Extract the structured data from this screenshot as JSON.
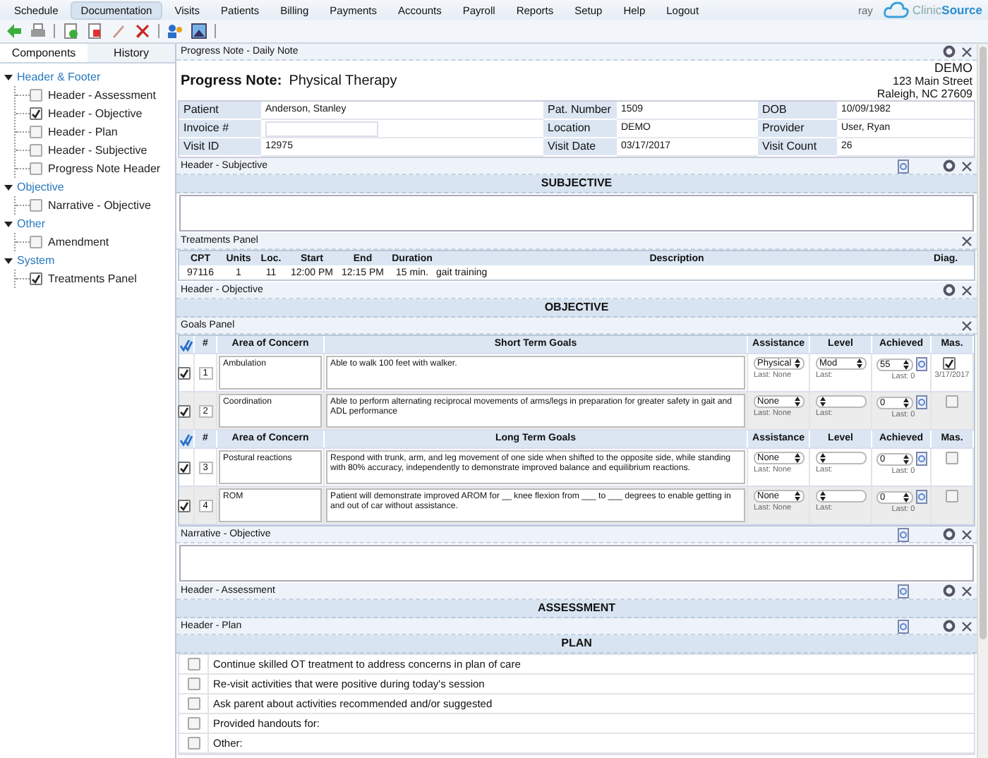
{
  "menu": [
    {
      "label": "Schedule",
      "selected": false
    },
    {
      "label": "Documentation",
      "selected": true
    },
    {
      "label": "Visits",
      "selected": false
    },
    {
      "label": "Patients",
      "selected": false
    },
    {
      "label": "Billing",
      "selected": false
    },
    {
      "label": "Payments",
      "selected": false
    },
    {
      "label": "Accounts",
      "selected": false
    },
    {
      "label": "Payroll",
      "selected": false
    },
    {
      "label": "Reports",
      "selected": false
    },
    {
      "label": "Setup",
      "selected": false
    },
    {
      "label": "Help",
      "selected": false
    },
    {
      "label": "Logout",
      "selected": false
    }
  ],
  "user": "ray",
  "logo": {
    "text_1": "Clinic",
    "text_2": "Source"
  },
  "sidebar": {
    "tabs": [
      {
        "label": "Components",
        "selected": true
      },
      {
        "label": "History",
        "selected": false
      }
    ],
    "groups": [
      {
        "label": "Header & Footer",
        "children": [
          {
            "label": "Header - Assessment",
            "checked": false
          },
          {
            "label": "Header - Objective",
            "checked": true
          },
          {
            "label": "Header - Plan",
            "checked": false
          },
          {
            "label": "Header - Subjective",
            "checked": false
          },
          {
            "label": "Progress Note Header",
            "checked": false
          }
        ]
      },
      {
        "label": "Objective",
        "children": [
          {
            "label": "Narrative - Objective",
            "checked": false
          }
        ]
      },
      {
        "label": "Other",
        "children": [
          {
            "label": "Amendment",
            "checked": false
          }
        ]
      },
      {
        "label": "System",
        "children": [
          {
            "label": "Treatments Panel",
            "checked": true
          }
        ]
      }
    ]
  },
  "note": {
    "panel_title": "Progress Note - Daily Note",
    "heading_label": "Progress Note:",
    "heading_value": "Physical Therapy",
    "clinic": [
      "DEMO",
      "123 Main Street",
      "Raleigh, NC 27609"
    ],
    "fields": [
      [
        {
          "label": "Patient",
          "value": "Anderson, Stanley"
        },
        {
          "label": "Pat. Number",
          "value": "1509"
        },
        {
          "label": "DOB",
          "value": "10/09/1982"
        }
      ],
      [
        {
          "label": "Invoice #",
          "kind": "input"
        },
        {
          "label": "Location",
          "value": "DEMO"
        },
        {
          "label": "Provider",
          "value": "User, Ryan"
        }
      ],
      [
        {
          "label": "Visit ID",
          "value": "12975"
        },
        {
          "label": "Visit Date",
          "value": "03/17/2017"
        },
        {
          "label": "Visit Count",
          "value": "26"
        }
      ]
    ]
  },
  "blocks": [
    {
      "kind": "bar",
      "title": "Header - Subjective",
      "copy": true,
      "settings": true
    },
    {
      "kind": "banner",
      "text": "SUBJECTIVE"
    },
    {
      "kind": "textarea"
    },
    {
      "kind": "bar",
      "title": "Treatments Panel",
      "copy": false,
      "settings": false
    },
    {
      "kind": "treatments",
      "columns": [
        "CPT",
        "Units",
        "Loc.",
        "Start",
        "End",
        "Duration",
        "Description",
        "Diag."
      ],
      "rows": [
        [
          "97116",
          "1",
          "11",
          "12:00 PM",
          "12:15 PM",
          "15 min.",
          "gait training"
        ]
      ]
    },
    {
      "kind": "bar",
      "title": "Header - Objective",
      "copy": false,
      "settings": true
    },
    {
      "kind": "banner",
      "text": "OBJECTIVE"
    },
    {
      "kind": "bar",
      "title": "Goals Panel",
      "copy": false,
      "settings": false
    },
    {
      "kind": "goals",
      "groups": [
        {
          "columns": [
            "#",
            "Area of Concern",
            "Short Term Goals",
            "Assistance",
            "Level",
            "Achieved",
            "Mas."
          ],
          "rows": [
            {
              "checked": true,
              "number": "1",
              "area": "Ambulation",
              "goal": "Able to walk  100 feet with walker.",
              "assistance": "Physical",
              "assistance_last": "Last: None",
              "level": "Mod",
              "level_last": "Last:",
              "achieved": "55",
              "achieved_last": "Last: 0",
              "mastered": true,
              "mastered_date": "3/17/2017"
            },
            {
              "checked": true,
              "number": "2",
              "area": "Coordination",
              "goal": "Able to perform alternating reciprocal movements of arms/legs in preparation for greater safety in gait and ADL performance",
              "assistance": "None",
              "assistance_last": "Last: None",
              "level_last": "Last:",
              "achieved": "0",
              "achieved_last": "Last: 0",
              "mastered": false
            }
          ]
        },
        {
          "columns": [
            "#",
            "Area of Concern",
            "Long Term Goals",
            "Assistance",
            "Level",
            "Achieved",
            "Mas."
          ],
          "rows": [
            {
              "checked": true,
              "number": "3",
              "area": "Postural reactions",
              "goal": "Respond with trunk, arm, and leg movement of one side when shifted to the opposite side, while standing with 80% accuracy, independently to demonstrate improved balance and equilibrium reactions.",
              "assistance": "None",
              "assistance_last": "Last: None",
              "level_last": "Last:",
              "achieved": "0",
              "achieved_last": "Last: 0",
              "mastered": false
            },
            {
              "checked": true,
              "number": "4",
              "area": "ROM",
              "goal": "Patient will demonstrate improved AROM for __ knee flexion from ___ to ___ degrees to enable getting in and out of car without assistance.",
              "assistance": "None",
              "assistance_last": "Last: None",
              "level_last": "Last:",
              "achieved": "0",
              "achieved_last": "Last: 0",
              "mastered": false
            }
          ]
        }
      ]
    },
    {
      "kind": "bar",
      "title": "Narrative - Objective",
      "copy": true,
      "settings": true
    },
    {
      "kind": "textarea"
    },
    {
      "kind": "bar",
      "title": "Header - Assessment",
      "copy": true,
      "settings": true
    },
    {
      "kind": "banner",
      "text": "ASSESSMENT"
    },
    {
      "kind": "bar",
      "title": "Header - Plan",
      "copy": true,
      "settings": true
    },
    {
      "kind": "banner",
      "text": "PLAN"
    },
    {
      "kind": "checklist",
      "items": [
        {
          "label": "Continue skilled OT treatment to address concerns in plan of care",
          "checked": false
        },
        {
          "label": "Re-visit activities that were positive during today's session",
          "checked": false
        },
        {
          "label": "Ask parent about activities recommended and/or suggested",
          "checked": false
        },
        {
          "label": "Provided handouts for:",
          "checked": false
        },
        {
          "label": "Other:",
          "checked": false
        }
      ]
    }
  ]
}
